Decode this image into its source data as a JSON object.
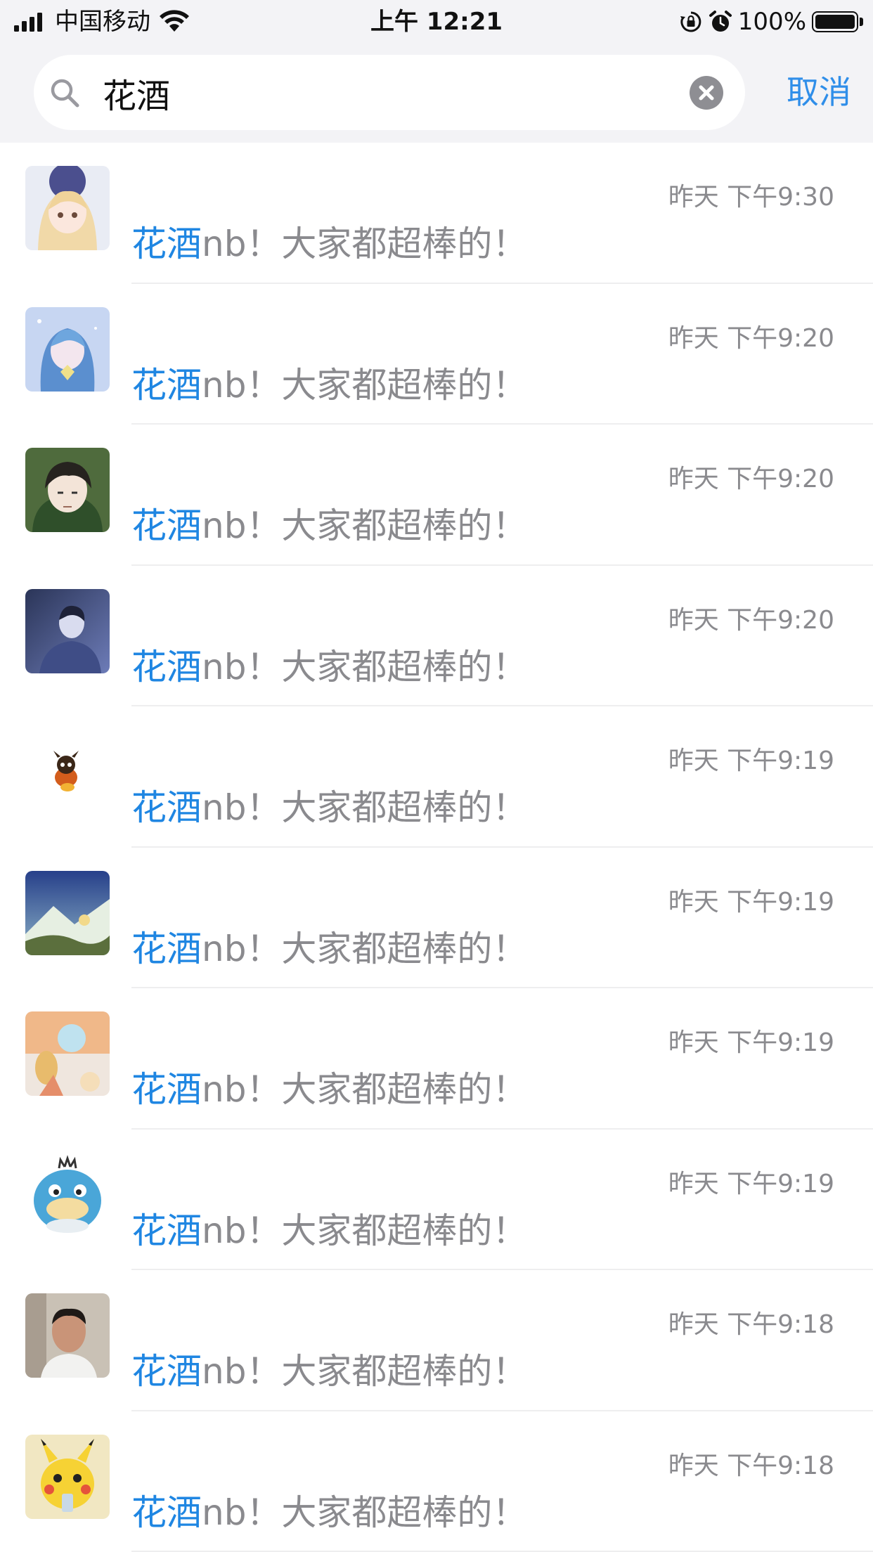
{
  "status_bar": {
    "carrier": "中国移动",
    "time": "上午 12:21",
    "battery": "100%"
  },
  "search": {
    "query": "花酒",
    "cancel_label": "取消"
  },
  "results": [
    {
      "highlight": "花酒",
      "rest": "nb！大家都超棒的！",
      "time": "昨天 下午9:30",
      "avatar_icon": "anime-girl-avatar"
    },
    {
      "highlight": "花酒",
      "rest": "nb！大家都超棒的！",
      "time": "昨天 下午9:20",
      "avatar_icon": "anime-blue-hair-avatar"
    },
    {
      "highlight": "花酒",
      "rest": "nb！大家都超棒的！",
      "time": "昨天 下午9:20",
      "avatar_icon": "anime-man-avatar"
    },
    {
      "highlight": "花酒",
      "rest": "nb！大家都超棒的！",
      "time": "昨天 下午9:20",
      "avatar_icon": "blue-portrait-avatar"
    },
    {
      "highlight": "花酒",
      "rest": "nb！大家都超棒的！",
      "time": "昨天 下午9:19",
      "avatar_icon": "small-creature-avatar"
    },
    {
      "highlight": "花酒",
      "rest": "nb！大家都超棒的！",
      "time": "昨天 下午9:19",
      "avatar_icon": "landscape-avatar"
    },
    {
      "highlight": "花酒",
      "rest": "nb！大家都超棒的！",
      "time": "昨天 下午9:19",
      "avatar_icon": "illustration-avatar"
    },
    {
      "highlight": "花酒",
      "rest": "nb！大家都超棒的！",
      "time": "昨天 下午9:19",
      "avatar_icon": "blue-duck-avatar"
    },
    {
      "highlight": "花酒",
      "rest": "nb！大家都超棒的！",
      "time": "昨天 下午9:18",
      "avatar_icon": "man-photo-avatar"
    },
    {
      "highlight": "花酒",
      "rest": "nb！大家都超棒的！",
      "time": "昨天 下午9:18",
      "avatar_icon": "pikachu-avatar"
    }
  ],
  "colors": {
    "accent": "#2f8ee9",
    "highlight": "#1f86e2",
    "muted_text": "#8a8a8e",
    "header_bg": "#f3f3f6"
  }
}
